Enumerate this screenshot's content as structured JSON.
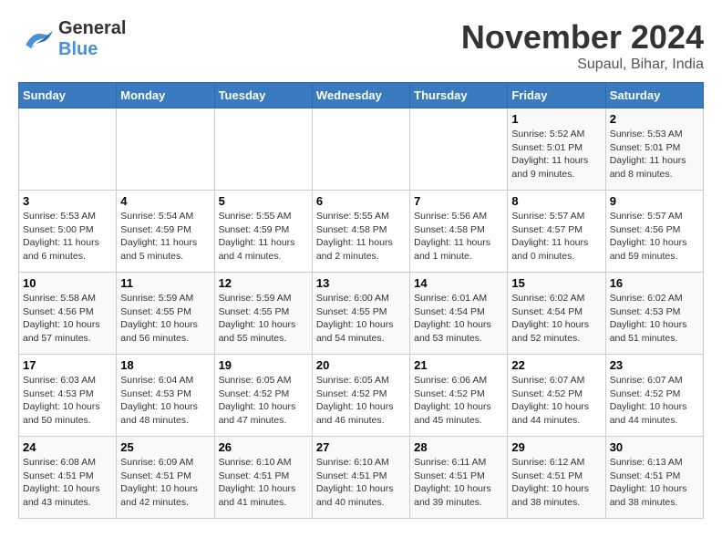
{
  "header": {
    "logo_line1": "General",
    "logo_line2": "Blue",
    "month": "November 2024",
    "location": "Supaul, Bihar, India"
  },
  "weekdays": [
    "Sunday",
    "Monday",
    "Tuesday",
    "Wednesday",
    "Thursday",
    "Friday",
    "Saturday"
  ],
  "weeks": [
    [
      {
        "day": "",
        "info": ""
      },
      {
        "day": "",
        "info": ""
      },
      {
        "day": "",
        "info": ""
      },
      {
        "day": "",
        "info": ""
      },
      {
        "day": "",
        "info": ""
      },
      {
        "day": "1",
        "info": "Sunrise: 5:52 AM\nSunset: 5:01 PM\nDaylight: 11 hours\nand 9 minutes."
      },
      {
        "day": "2",
        "info": "Sunrise: 5:53 AM\nSunset: 5:01 PM\nDaylight: 11 hours\nand 8 minutes."
      }
    ],
    [
      {
        "day": "3",
        "info": "Sunrise: 5:53 AM\nSunset: 5:00 PM\nDaylight: 11 hours\nand 6 minutes."
      },
      {
        "day": "4",
        "info": "Sunrise: 5:54 AM\nSunset: 4:59 PM\nDaylight: 11 hours\nand 5 minutes."
      },
      {
        "day": "5",
        "info": "Sunrise: 5:55 AM\nSunset: 4:59 PM\nDaylight: 11 hours\nand 4 minutes."
      },
      {
        "day": "6",
        "info": "Sunrise: 5:55 AM\nSunset: 4:58 PM\nDaylight: 11 hours\nand 2 minutes."
      },
      {
        "day": "7",
        "info": "Sunrise: 5:56 AM\nSunset: 4:58 PM\nDaylight: 11 hours\nand 1 minute."
      },
      {
        "day": "8",
        "info": "Sunrise: 5:57 AM\nSunset: 4:57 PM\nDaylight: 11 hours\nand 0 minutes."
      },
      {
        "day": "9",
        "info": "Sunrise: 5:57 AM\nSunset: 4:56 PM\nDaylight: 10 hours\nand 59 minutes."
      }
    ],
    [
      {
        "day": "10",
        "info": "Sunrise: 5:58 AM\nSunset: 4:56 PM\nDaylight: 10 hours\nand 57 minutes."
      },
      {
        "day": "11",
        "info": "Sunrise: 5:59 AM\nSunset: 4:55 PM\nDaylight: 10 hours\nand 56 minutes."
      },
      {
        "day": "12",
        "info": "Sunrise: 5:59 AM\nSunset: 4:55 PM\nDaylight: 10 hours\nand 55 minutes."
      },
      {
        "day": "13",
        "info": "Sunrise: 6:00 AM\nSunset: 4:55 PM\nDaylight: 10 hours\nand 54 minutes."
      },
      {
        "day": "14",
        "info": "Sunrise: 6:01 AM\nSunset: 4:54 PM\nDaylight: 10 hours\nand 53 minutes."
      },
      {
        "day": "15",
        "info": "Sunrise: 6:02 AM\nSunset: 4:54 PM\nDaylight: 10 hours\nand 52 minutes."
      },
      {
        "day": "16",
        "info": "Sunrise: 6:02 AM\nSunset: 4:53 PM\nDaylight: 10 hours\nand 51 minutes."
      }
    ],
    [
      {
        "day": "17",
        "info": "Sunrise: 6:03 AM\nSunset: 4:53 PM\nDaylight: 10 hours\nand 50 minutes."
      },
      {
        "day": "18",
        "info": "Sunrise: 6:04 AM\nSunset: 4:53 PM\nDaylight: 10 hours\nand 48 minutes."
      },
      {
        "day": "19",
        "info": "Sunrise: 6:05 AM\nSunset: 4:52 PM\nDaylight: 10 hours\nand 47 minutes."
      },
      {
        "day": "20",
        "info": "Sunrise: 6:05 AM\nSunset: 4:52 PM\nDaylight: 10 hours\nand 46 minutes."
      },
      {
        "day": "21",
        "info": "Sunrise: 6:06 AM\nSunset: 4:52 PM\nDaylight: 10 hours\nand 45 minutes."
      },
      {
        "day": "22",
        "info": "Sunrise: 6:07 AM\nSunset: 4:52 PM\nDaylight: 10 hours\nand 44 minutes."
      },
      {
        "day": "23",
        "info": "Sunrise: 6:07 AM\nSunset: 4:52 PM\nDaylight: 10 hours\nand 44 minutes."
      }
    ],
    [
      {
        "day": "24",
        "info": "Sunrise: 6:08 AM\nSunset: 4:51 PM\nDaylight: 10 hours\nand 43 minutes."
      },
      {
        "day": "25",
        "info": "Sunrise: 6:09 AM\nSunset: 4:51 PM\nDaylight: 10 hours\nand 42 minutes."
      },
      {
        "day": "26",
        "info": "Sunrise: 6:10 AM\nSunset: 4:51 PM\nDaylight: 10 hours\nand 41 minutes."
      },
      {
        "day": "27",
        "info": "Sunrise: 6:10 AM\nSunset: 4:51 PM\nDaylight: 10 hours\nand 40 minutes."
      },
      {
        "day": "28",
        "info": "Sunrise: 6:11 AM\nSunset: 4:51 PM\nDaylight: 10 hours\nand 39 minutes."
      },
      {
        "day": "29",
        "info": "Sunrise: 6:12 AM\nSunset: 4:51 PM\nDaylight: 10 hours\nand 38 minutes."
      },
      {
        "day": "30",
        "info": "Sunrise: 6:13 AM\nSunset: 4:51 PM\nDaylight: 10 hours\nand 38 minutes."
      }
    ]
  ]
}
